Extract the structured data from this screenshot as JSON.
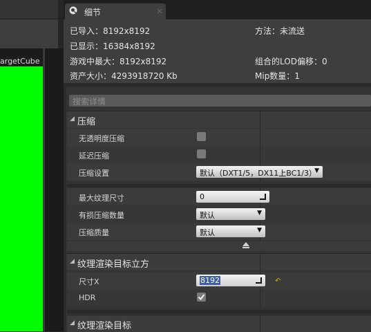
{
  "left_panel": {
    "preview_label": "argetCube"
  },
  "tab": {
    "title": "细节",
    "close": "×"
  },
  "info": {
    "imported": "已导入：8192x8192",
    "displayed": "已显示：16384x8192",
    "max_in_game": "游戏中最大：8192x8192",
    "resource_size": "资产大小：4293918720 Kb",
    "method": "方法：未流送",
    "lod_bias": "组合的LOD偏移：0",
    "mip_count": "Mip数量：1"
  },
  "search": {
    "placeholder": "搜索详情"
  },
  "compression": {
    "title": "压缩",
    "rows": [
      {
        "label": "无透明度压缩"
      },
      {
        "label": "延迟压缩"
      },
      {
        "label": "压缩设置",
        "value": "默认（DXT1/5，DX11上BC1/3）"
      }
    ],
    "advanced": [
      {
        "label": "最大纹理尺寸",
        "value": "0"
      },
      {
        "label": "有损压缩数量",
        "value": "默认"
      },
      {
        "label": "压缩质量",
        "value": "默认"
      }
    ]
  },
  "render_target_cube": {
    "title": "纹理渲染目标立方",
    "rows": [
      {
        "label": "尺寸X",
        "value": "8192"
      },
      {
        "label": "HDR"
      }
    ]
  },
  "render_target": {
    "title": "纹理渲染目标"
  },
  "colors": {
    "preview": "#00ff00",
    "reset_arrow": "#d4b000"
  }
}
